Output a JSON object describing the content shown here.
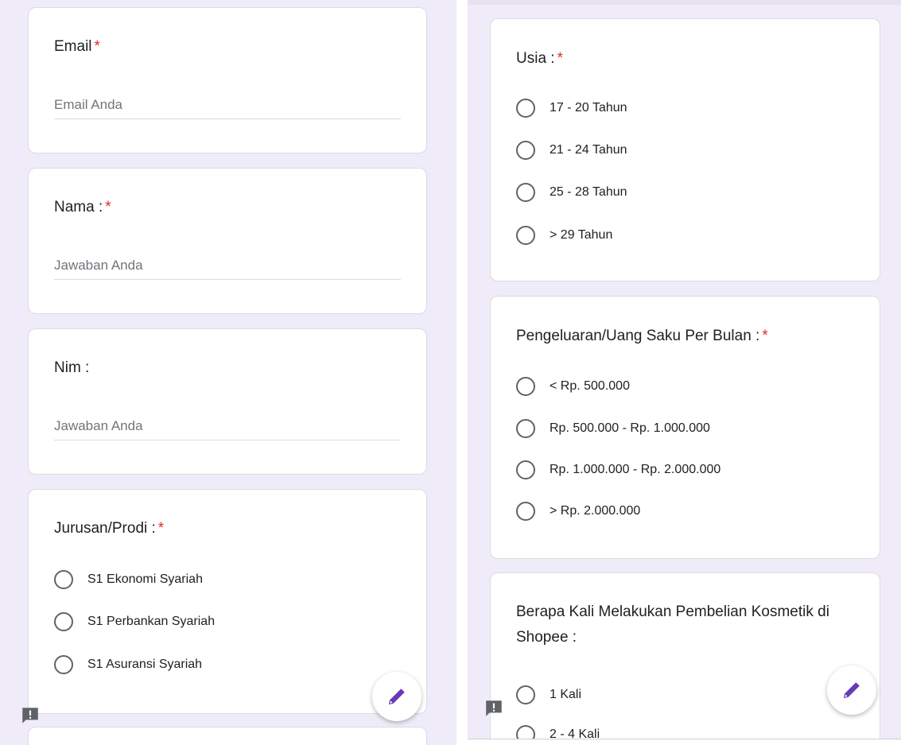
{
  "left": {
    "email": {
      "title": "Email",
      "required_mark": "*",
      "placeholder": "Email Anda"
    },
    "nama": {
      "title": "Nama :",
      "required_mark": "*",
      "placeholder": "Jawaban Anda"
    },
    "nim": {
      "title": "Nim :",
      "placeholder": "Jawaban Anda"
    },
    "jurusan": {
      "title": "Jurusan/Prodi :",
      "required_mark": "*",
      "options": [
        "S1 Ekonomi Syariah",
        "S1 Perbankan Syariah",
        "S1 Asuransi Syariah"
      ]
    }
  },
  "right": {
    "usia": {
      "title": "Usia :",
      "required_mark": "*",
      "options": [
        "17 - 20 Tahun",
        "21 - 24 Tahun",
        "25 - 28 Tahun",
        "> 29 Tahun"
      ]
    },
    "pengeluaran": {
      "title": "Pengeluaran/Uang Saku Per Bulan :",
      "required_mark": "*",
      "options": [
        "< Rp. 500.000",
        "Rp. 500.000 - Rp. 1.000.000",
        "Rp. 1.000.000 - Rp. 2.000.000",
        "> Rp. 2.000.000"
      ]
    },
    "pembelian": {
      "title": "Berapa Kali Melakukan Pembelian Kosmetik di Shopee :",
      "options": [
        "1 Kali",
        "2 - 4 Kali"
      ]
    }
  },
  "icons": {
    "fab": "pencil-icon",
    "feedback": "report-issue-icon"
  },
  "colors": {
    "accent": "#673ab7",
    "background": "#f0ebf8",
    "required": "#d93025",
    "card": "#ffffff"
  }
}
